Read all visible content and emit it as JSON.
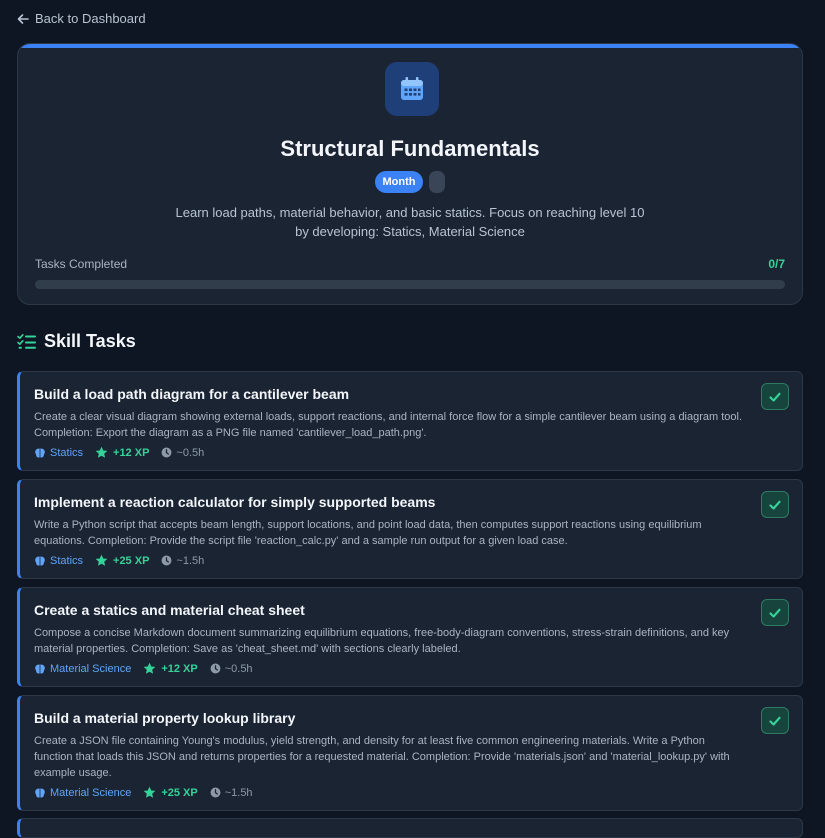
{
  "nav": {
    "back_label": "Back to Dashboard"
  },
  "goal": {
    "icon": "calendar-icon",
    "title": "Structural Fundamentals",
    "period_badge": "Month",
    "description": "Learn load paths, material behavior, and basic statics. Focus on reaching level 10 by developing: Statics, Material Science",
    "progress_label": "Tasks Completed",
    "progress_count": "0/7",
    "progress_fraction": 0.0
  },
  "section": {
    "icon": "checklist-icon",
    "title": "Skill Tasks"
  },
  "colors": {
    "accent": "#3b82f6",
    "success": "#34d399",
    "background": "#0e1623",
    "card": "#1a2432"
  },
  "tasks": [
    {
      "title": "Build a load path diagram for a cantilever beam",
      "description": "Create a clear visual diagram showing external loads, support reactions, and internal force flow for a simple cantilever beam using a diagram tool. Completion: Export the diagram as a PNG file named 'cantilever_load_path.png'.",
      "skill": "Statics",
      "xp": "+12 XP",
      "time": "~0.5h"
    },
    {
      "title": "Implement a reaction calculator for simply supported beams",
      "description": "Write a Python script that accepts beam length, support locations, and point load data, then computes support reactions using equilibrium equations. Completion: Provide the script file 'reaction_calc.py' and a sample run output for a given load case.",
      "skill": "Statics",
      "xp": "+25 XP",
      "time": "~1.5h"
    },
    {
      "title": "Create a statics and material cheat sheet",
      "description": "Compose a concise Markdown document summarizing equilibrium equations, free-body-diagram conventions, stress-strain definitions, and key material properties. Completion: Save as 'cheat_sheet.md' with sections clearly labeled.",
      "skill": "Material Science",
      "xp": "+12 XP",
      "time": "~0.5h"
    },
    {
      "title": "Build a material property lookup library",
      "description": "Create a JSON file containing Young's modulus, yield strength, and density for at least five common engineering materials. Write a Python function that loads this JSON and returns properties for a requested material. Completion: Provide 'materials.json' and 'material_lookup.py' with example usage.",
      "skill": "Material Science",
      "xp": "+25 XP",
      "time": "~1.5h"
    }
  ]
}
